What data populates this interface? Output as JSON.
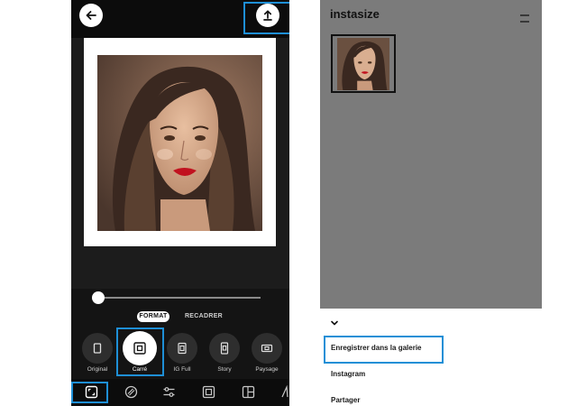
{
  "editor": {
    "tabs": [
      {
        "label": "FORMAT",
        "active": true
      },
      {
        "label": "RECADRER",
        "active": false
      }
    ],
    "formats": [
      {
        "label": "Original",
        "icon": "portrait-rect-icon"
      },
      {
        "label": "Carré",
        "icon": "square-frame-icon",
        "selected": true
      },
      {
        "label": "IG Full",
        "icon": "ig-full-icon"
      },
      {
        "label": "Story",
        "icon": "story-icon"
      },
      {
        "label": "Paysage",
        "icon": "landscape-icon"
      }
    ],
    "slider_value": 0,
    "toolbar_icons": [
      "crop-format-icon",
      "filter-icon",
      "adjust-icon",
      "frame-icon",
      "layout-icon",
      "text-icon"
    ]
  },
  "share": {
    "brand": "instasize",
    "options": [
      {
        "label": "Enregistrer dans la galerie",
        "highlighted": true
      },
      {
        "label": "Instagram"
      },
      {
        "label": "Partager"
      }
    ]
  },
  "colors": {
    "highlight": "#1e8fd6",
    "editor_bg": "#141414",
    "lips": "#c1121f"
  }
}
